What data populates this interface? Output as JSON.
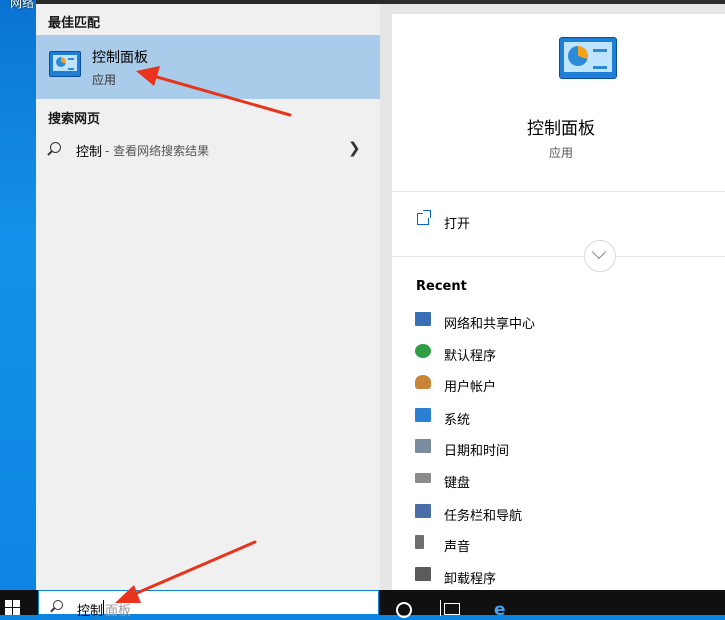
{
  "desktop": {
    "icon_label": "网络"
  },
  "best_match": {
    "header": "最佳匹配",
    "app_name": "控制面板",
    "app_type": "应用",
    "icon": "control-panel-icon"
  },
  "web": {
    "header": "搜索网页",
    "term": "控制",
    "hint": "- 查看网络搜索结果"
  },
  "detail": {
    "title": "控制面板",
    "type": "应用",
    "open_label": "打开",
    "recent_header": "Recent",
    "recent_items": [
      {
        "label": "网络和共享中心",
        "icon": "network-sharing-icon",
        "color": "#3b6fb5"
      },
      {
        "label": "默认程序",
        "icon": "default-programs-icon",
        "color": "#2f9e44"
      },
      {
        "label": "用户帐户",
        "icon": "user-accounts-icon",
        "color": "#c9843a"
      },
      {
        "label": "系统",
        "icon": "system-icon",
        "color": "#2d7fd3"
      },
      {
        "label": "日期和时间",
        "icon": "date-time-icon",
        "color": "#7a8aa0"
      },
      {
        "label": "键盘",
        "icon": "keyboard-icon",
        "color": "#8c8c8c"
      },
      {
        "label": "任务栏和导航",
        "icon": "taskbar-navigation-icon",
        "color": "#4a6da7"
      },
      {
        "label": "声音",
        "icon": "sound-icon",
        "color": "#6f6f6f"
      },
      {
        "label": "卸载程序",
        "icon": "uninstall-program-icon",
        "color": "#5b5b5b"
      }
    ]
  },
  "taskbar": {
    "search_typed": "控制",
    "search_suggestion": "面板"
  },
  "colors": {
    "highlight": "#a9ccea",
    "arrow": "#e8341c",
    "accent": "#0a84e0"
  }
}
